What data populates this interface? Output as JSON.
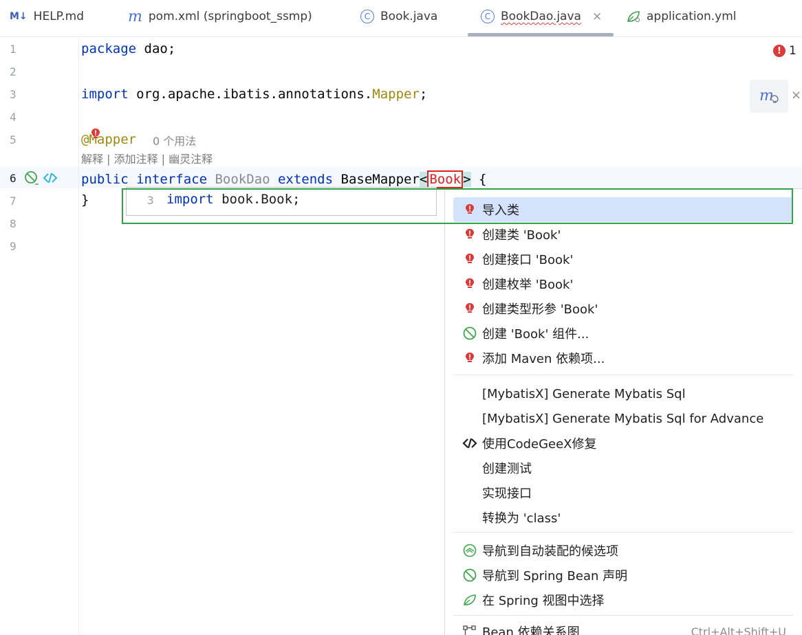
{
  "tabs": [
    {
      "label": "HELP.md",
      "icon": "markdown-icon"
    },
    {
      "label": "pom.xml (springboot_ssmp)",
      "icon": "maven-icon"
    },
    {
      "label": "Book.java",
      "icon": "class-icon"
    },
    {
      "label": "BookDao.java",
      "icon": "class-icon",
      "active": true,
      "close": "×"
    },
    {
      "label": "application.yml",
      "icon": "spring-leaf-icon"
    }
  ],
  "gutter": {
    "lines": [
      "1",
      "2",
      "3",
      "4",
      "5",
      "6",
      "7",
      "8",
      "9"
    ]
  },
  "code": {
    "line1_kw": "package",
    "line1_rest": " dao;",
    "line3_kw": "import",
    "line3_pkg": " org.apache.ibatis.annotations.",
    "line3_cls": "Mapper",
    "line3_end": ";",
    "line5_at": "@",
    "line5_ann": "Mapper",
    "usages": "0 个用法",
    "hint": "解释 | 添加注释 | 幽灵注释",
    "line6_public": "public",
    "line6_interface": " interface",
    "line6_name": " BookDao",
    "line6_extends": " extends",
    "line6_base": " BaseMapper",
    "line6_lt": "<",
    "line6_book": "Book",
    "line6_gt": ">",
    "line6_brace": " {",
    "line7": "}"
  },
  "error_count": "1",
  "error_mark": "!",
  "preview": {
    "line_no": "3",
    "kw": "import",
    "rest": " book.Book;"
  },
  "menu": {
    "group1": [
      {
        "label": "导入类",
        "icon": "error-bulb-icon",
        "selected": true
      },
      {
        "label": "创建类 'Book'",
        "icon": "error-bulb-icon"
      },
      {
        "label": "创建接口 'Book'",
        "icon": "error-bulb-icon"
      },
      {
        "label": "创建枚举 'Book'",
        "icon": "error-bulb-icon"
      },
      {
        "label": "创建类型形参 'Book'",
        "icon": "error-bulb-icon"
      },
      {
        "label": "创建 'Book' 组件...",
        "icon": "spring-bean-icon"
      },
      {
        "label": "添加 Maven 依赖项...",
        "icon": "error-bulb-icon"
      }
    ],
    "group2": [
      {
        "label": "[MybatisX] Generate Mybatis Sql",
        "icon": ""
      },
      {
        "label": "[MybatisX] Generate Mybatis Sql for Advance",
        "icon": ""
      },
      {
        "label": "使用CodeGeeX修复",
        "icon": "codegeex-icon"
      },
      {
        "label": "创建测试",
        "icon": ""
      },
      {
        "label": "实现接口",
        "icon": ""
      },
      {
        "label": "转换为 'class'",
        "icon": ""
      }
    ],
    "group3": [
      {
        "label": "导航到自动装配的候选项",
        "icon": "autowired-icon"
      },
      {
        "label": "导航到 Spring Bean 声明",
        "icon": "spring-bean-icon"
      },
      {
        "label": "在 Spring 视图中选择",
        "icon": "spring-leaf-icon"
      }
    ],
    "group4": [
      {
        "label": "Bean 依赖关系图",
        "icon": "diagram-icon",
        "shortcut": "Ctrl+Alt+Shift+U"
      }
    ]
  },
  "colors": {
    "keyword": "#0033b3",
    "annotation": "#9e880d",
    "error": "#d93a3a",
    "selection": "#d4e2fb",
    "highlight_frame": "#2ea548",
    "book_frame": "#e0231b"
  }
}
